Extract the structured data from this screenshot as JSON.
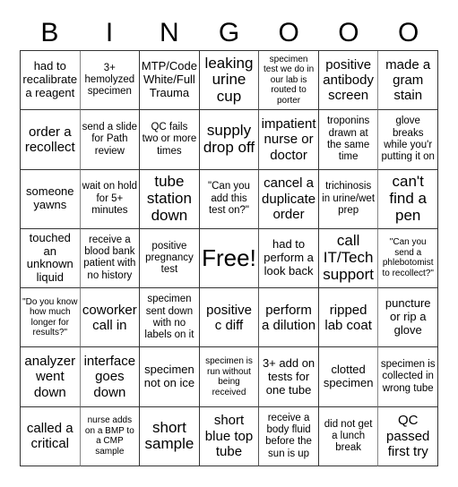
{
  "header": {
    "letters": [
      "B",
      "I",
      "N",
      "G",
      "O",
      "O",
      "O"
    ]
  },
  "board": {
    "cells": [
      "had to recalibrate a reagent",
      "3+ hemolyzed specimen",
      "MTP/Code White/Full Trauma",
      "leaking urine cup",
      "specimen test we do in our lab is routed to porter",
      "positive antibody screen",
      "made a gram stain",
      "order a recollect",
      "send a slide for Path review",
      "QC fails two or more times",
      "supply drop off",
      "impatient nurse or doctor",
      "troponins drawn at the same time",
      "glove breaks while you'r putting it on",
      "someone yawns",
      "wait on hold for 5+ minutes",
      "tube station down",
      "\"Can you add this test on?\"",
      "cancel a duplicate order",
      "trichinosis in urine/wet prep",
      "can't find a pen",
      "touched an unknown liquid",
      "receive a blood bank patient with no history",
      "positive pregnancy test",
      "Free!",
      "had to perform a look back",
      "call IT/Tech support",
      "\"Can you send a phlebotomist to recollect?\"",
      "\"Do you know how much longer for results?\"",
      "coworker call in",
      "specimen sent down with no labels on it",
      "positive c diff",
      "perform a dilution",
      "ripped lab coat",
      "puncture or rip a glove",
      "analyzer went down",
      "interface goes down",
      "specimen not on ice",
      "specimen is run without being received",
      "3+ add on tests for one tube",
      "clotted specimen",
      "specimen is collected in wrong tube",
      "called a critical",
      "nurse adds on a BMP to a CMP sample",
      "short sample",
      "short blue top tube",
      "receive a body fluid before the sun is up",
      "did not get a lunch break",
      "QC passed first try"
    ]
  }
}
